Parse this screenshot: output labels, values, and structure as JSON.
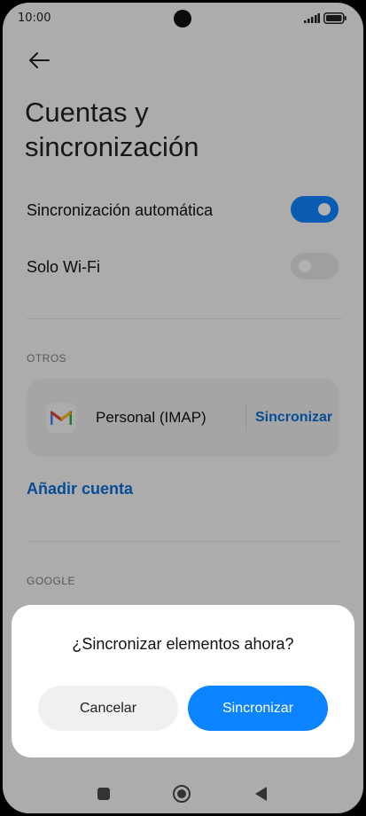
{
  "status_bar": {
    "time": "10:00",
    "icons": [
      "signal-icon",
      "battery-icon"
    ]
  },
  "header": {
    "back_icon": "back-arrow-icon",
    "title": "Cuentas y sincronización"
  },
  "settings": {
    "auto_sync": {
      "label": "Sincronización automática",
      "enabled": true
    },
    "wifi_only": {
      "label": "Solo Wi-Fi",
      "enabled": false
    }
  },
  "sections": {
    "others_label": "OTROS",
    "google_label": "GOOGLE"
  },
  "account": {
    "icon": "gmail-icon",
    "name": "Personal (IMAP)",
    "sync_label": "Sincronizar"
  },
  "add_account_label": "Añadir cuenta",
  "dialog": {
    "title": "¿Sincronizar elementos ahora?",
    "cancel_label": "Cancelar",
    "confirm_label": "Sincronizar"
  },
  "nav_bar": {
    "icons": [
      "recents-icon",
      "home-icon",
      "back-icon"
    ]
  },
  "colors": {
    "accent": "#0d84ff",
    "link": "#0a6ed6",
    "background": "#f7f7f7"
  }
}
